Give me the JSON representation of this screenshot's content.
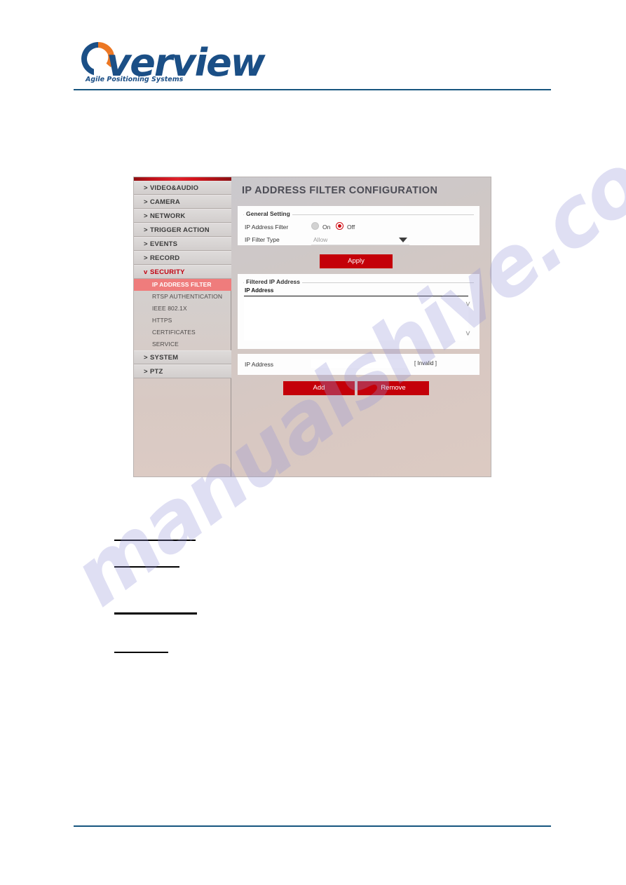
{
  "header": {
    "brand_word": "verview",
    "tagline": "Agile Positioning Systems",
    "brand_blue": "#1b4f86",
    "brand_orange": "#ec7723",
    "rule_color": "#17557f"
  },
  "watermark": {
    "text": "manualshive.com"
  },
  "ui": {
    "panel_title": "IP ADDRESS FILTER CONFIGURATION",
    "accent_red": "#c40009",
    "selected_red": "#ef7c7c",
    "sidebar": {
      "top_items": [
        {
          "chevron": ">",
          "label": "VIDEO&AUDIO"
        },
        {
          "chevron": ">",
          "label": "CAMERA"
        },
        {
          "chevron": ">",
          "label": "NETWORK"
        },
        {
          "chevron": ">",
          "label": "TRIGGER ACTION"
        },
        {
          "chevron": ">",
          "label": "EVENTS"
        },
        {
          "chevron": ">",
          "label": "RECORD"
        },
        {
          "chevron": "v",
          "label": "SECURITY"
        }
      ],
      "security_children": [
        {
          "label": "IP ADDRESS FILTER",
          "selected": true
        },
        {
          "label": "RTSP AUTHENTICATION",
          "selected": false
        },
        {
          "label": "IEEE 802.1X",
          "selected": false
        },
        {
          "label": "HTTPS",
          "selected": false
        },
        {
          "label": "CERTIFICATES",
          "selected": false
        },
        {
          "label": "SERVICE",
          "selected": false
        }
      ],
      "bottom_items": [
        {
          "chevron": ">",
          "label": "SYSTEM"
        },
        {
          "chevron": ">",
          "label": "PTZ"
        }
      ]
    },
    "general_setting": {
      "legend": "General Setting",
      "ip_address_filter_label": "IP Address Filter",
      "radio_on_label": "On",
      "radio_off_label": "Off",
      "selected_radio": "Off",
      "ip_filter_type_label": "IP Filter Type",
      "ip_filter_type_value": "Allow",
      "dropdown_arrow_icon": "chevron-down-icon"
    },
    "apply_button": "Apply",
    "filtered_ip": {
      "legend": "Filtered IP Address",
      "column_header": "IP Address",
      "rows": [],
      "scroll_up_icon": "chevron-up-icon",
      "scroll_down_icon": "chevron-down-icon"
    },
    "ip_entry": {
      "label": "IP Address",
      "value": "",
      "status": "[ Invalid ]"
    },
    "add_button": "Add",
    "remove_button": "Remove"
  }
}
